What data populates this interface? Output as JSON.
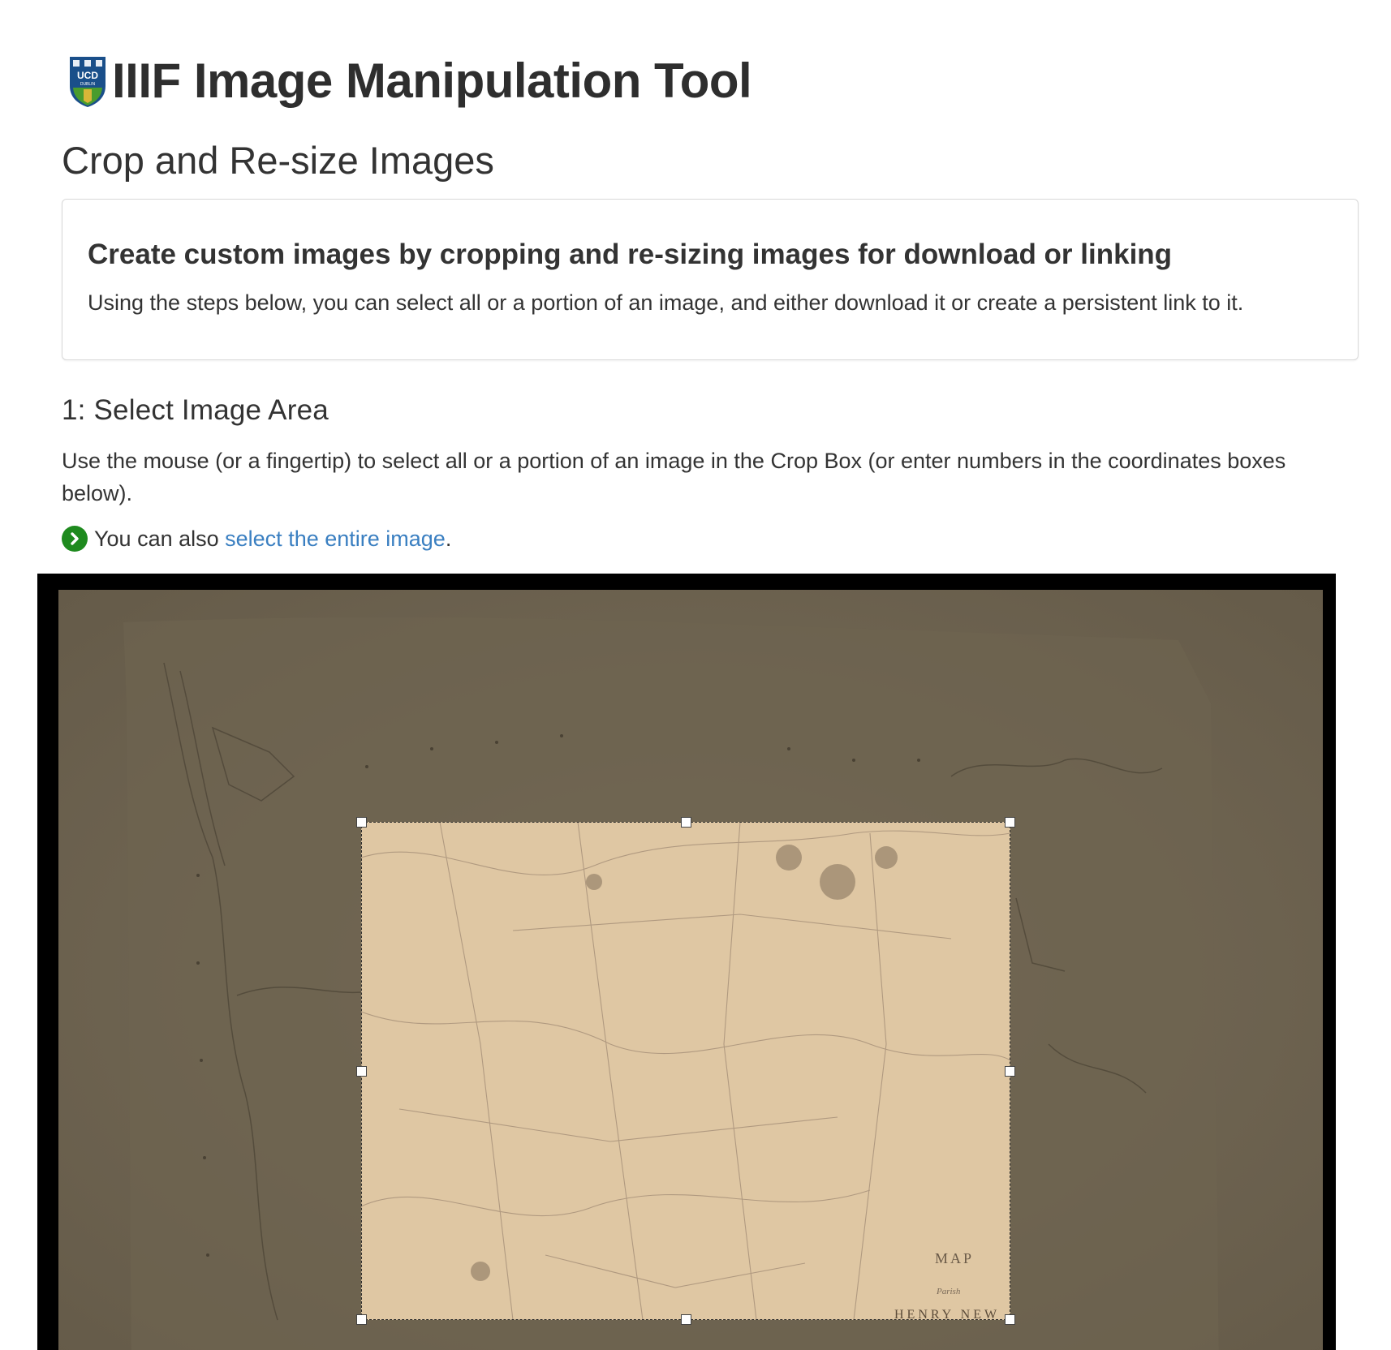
{
  "header": {
    "logo_icon": "ucd-crest-icon",
    "logo_text": "UCD",
    "logo_subtext": "DUBLIN",
    "app_title": "IIIF Image Manipulation Tool"
  },
  "section": {
    "title": "Crop and Re-size Images"
  },
  "intro": {
    "heading": "Create custom images by cropping and re-sizing images for download or linking",
    "text": "Using the steps below, you can select all or a portion of an image, and either download it or create a persistent link to it."
  },
  "step1": {
    "heading": "1: Select Image Area",
    "instructions": "Use the mouse (or a fingertip) to select all or a portion of an image in the Crop Box (or enter numbers in the coordinates boxes below).",
    "also_prefix": "You can also ",
    "also_link": "select the entire image",
    "also_suffix": ".",
    "go_icon": "chevron-right-circle-icon"
  },
  "crop_tool": {
    "map_label_1": "MAP",
    "map_label_2": "Parish",
    "map_label_3": "HENRY NEW"
  },
  "colors": {
    "link": "#3a7fc1",
    "go_icon": "#1e8a1e",
    "logo_blue": "#1a4f8a",
    "logo_green": "#4a9c2d",
    "map_dim": "#6c6250",
    "map_selected": "#dfc7a3"
  }
}
